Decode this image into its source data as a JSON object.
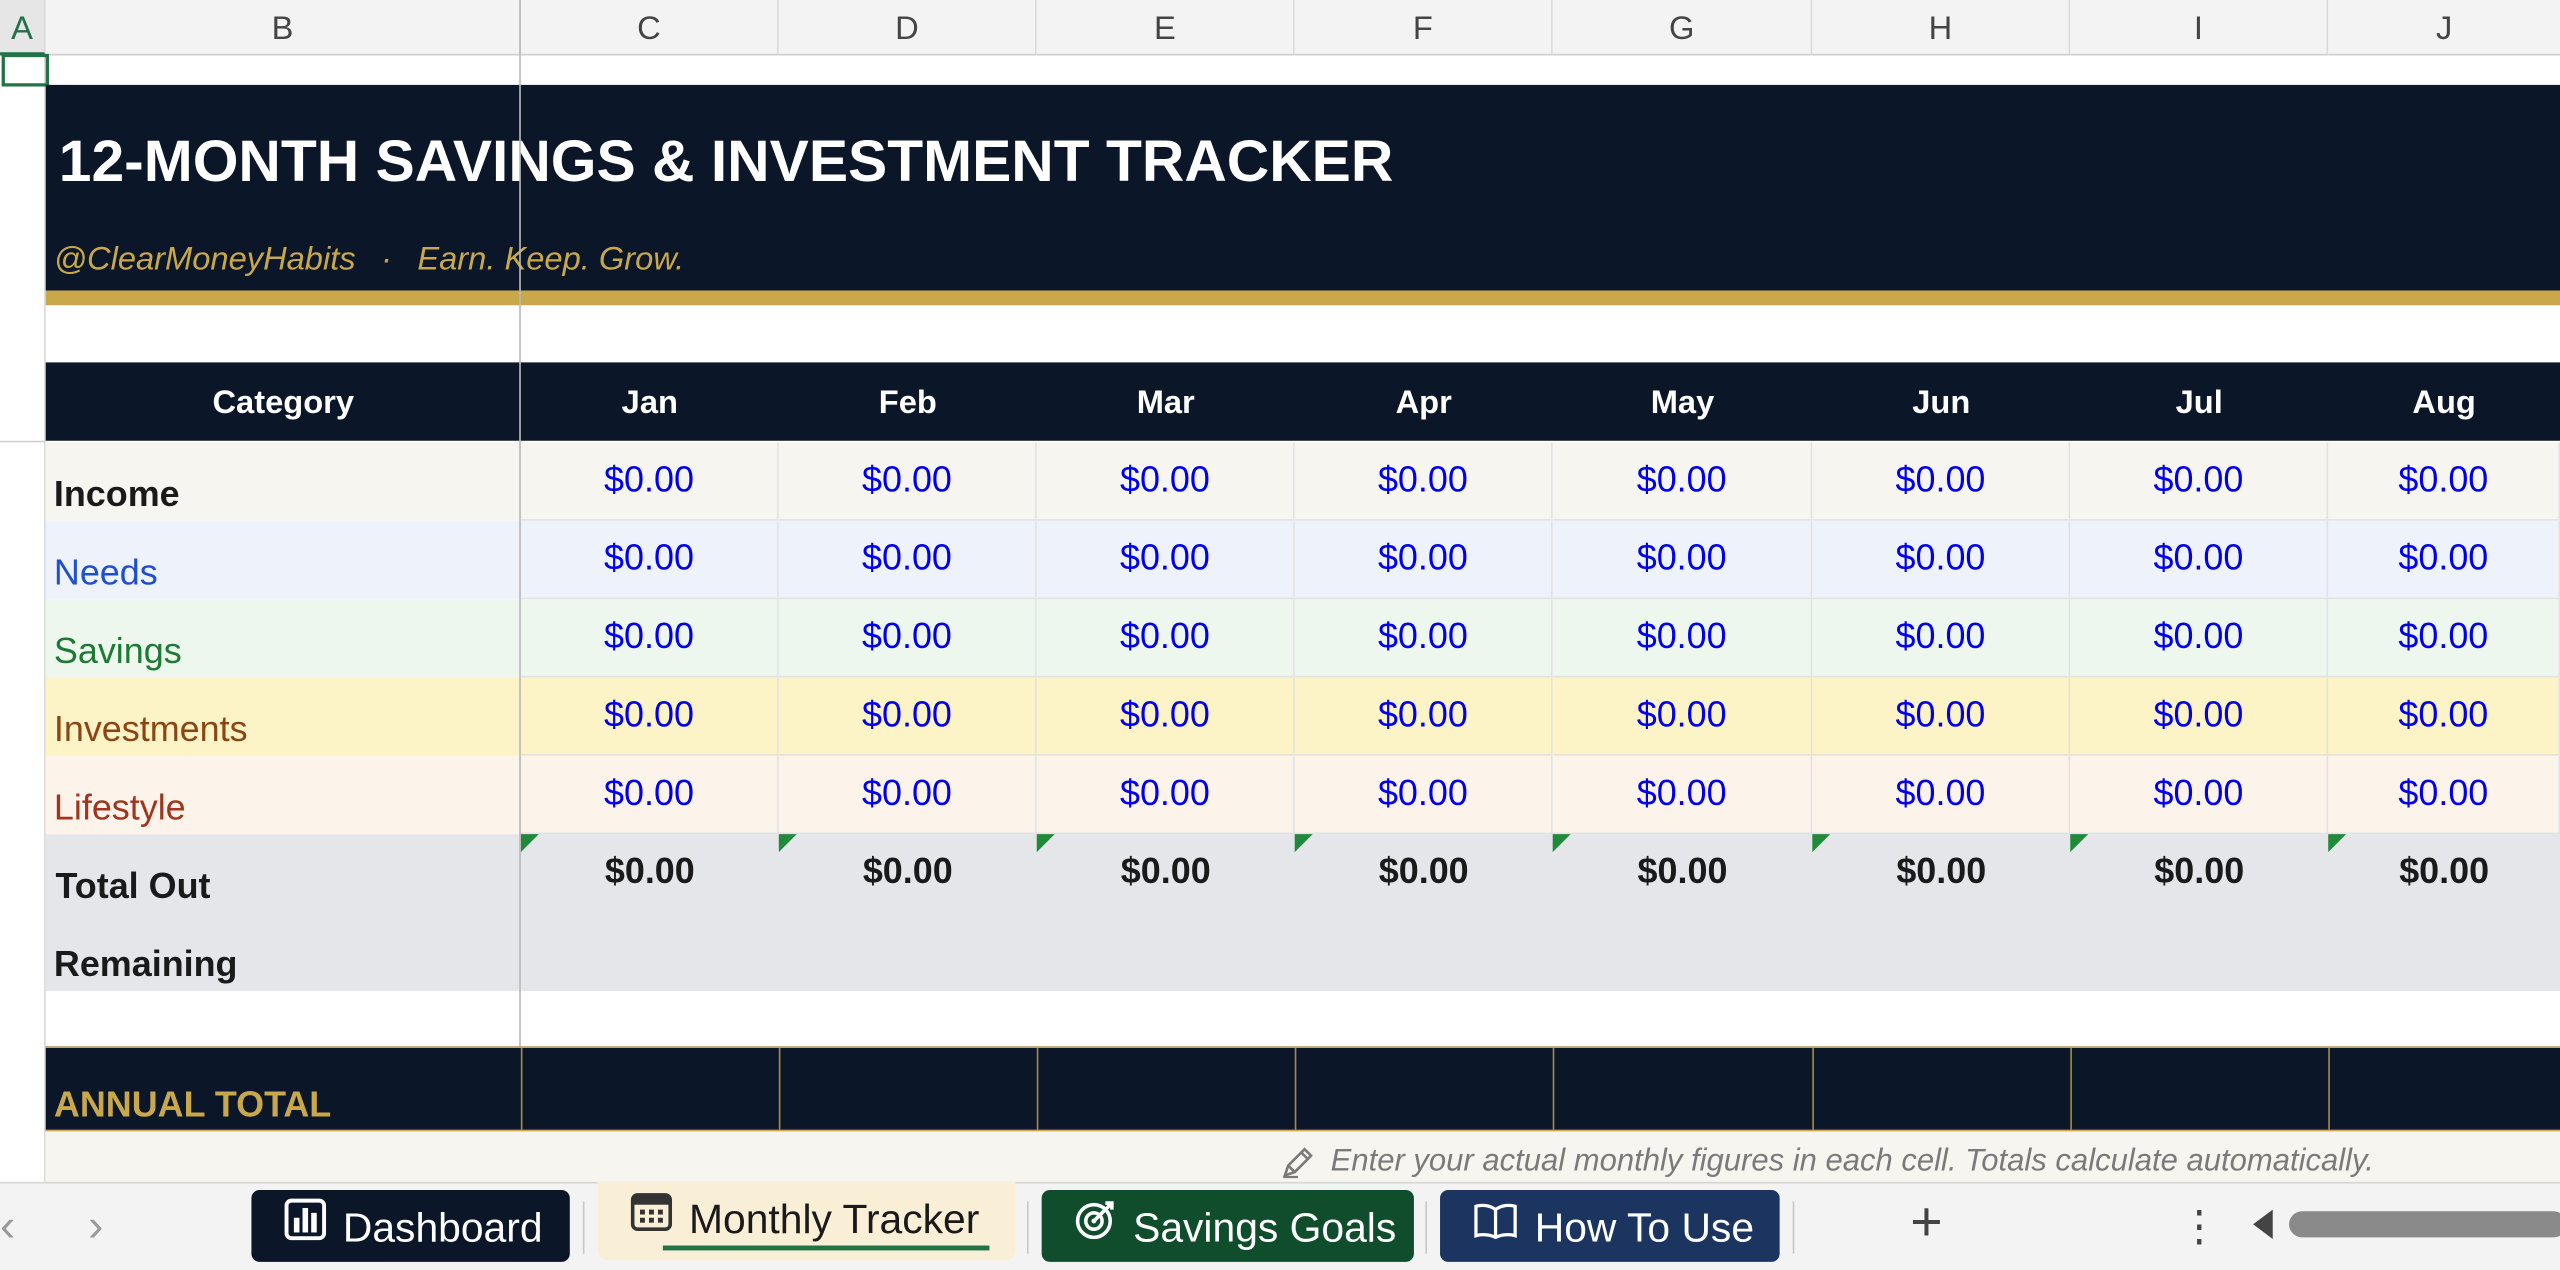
{
  "columns": {
    "letters": [
      "A",
      "B",
      "C",
      "D",
      "E",
      "F",
      "G",
      "H",
      "I",
      "J"
    ]
  },
  "banner": {
    "title": "12-MONTH SAVINGS & INVESTMENT TRACKER",
    "handle": "@ClearMoneyHabits",
    "separator": "·",
    "slogan": "Earn. Keep. Grow."
  },
  "table": {
    "header_category": "Category",
    "months": [
      "Jan",
      "Feb",
      "Mar",
      "Apr",
      "May",
      "Jun",
      "Jul",
      "Aug"
    ],
    "rows": [
      {
        "label": "Income",
        "values": [
          "$0.00",
          "$0.00",
          "$0.00",
          "$0.00",
          "$0.00",
          "$0.00",
          "$0.00",
          "$0.00"
        ]
      },
      {
        "label": "Needs",
        "values": [
          "$0.00",
          "$0.00",
          "$0.00",
          "$0.00",
          "$0.00",
          "$0.00",
          "$0.00",
          "$0.00"
        ]
      },
      {
        "label": "Savings",
        "values": [
          "$0.00",
          "$0.00",
          "$0.00",
          "$0.00",
          "$0.00",
          "$0.00",
          "$0.00",
          "$0.00"
        ]
      },
      {
        "label": "Investments",
        "values": [
          "$0.00",
          "$0.00",
          "$0.00",
          "$0.00",
          "$0.00",
          "$0.00",
          "$0.00",
          "$0.00"
        ]
      },
      {
        "label": "Lifestyle",
        "values": [
          "$0.00",
          "$0.00",
          "$0.00",
          "$0.00",
          "$0.00",
          "$0.00",
          "$0.00",
          "$0.00"
        ]
      },
      {
        "label": "Total Out",
        "values": [
          "$0.00",
          "$0.00",
          "$0.00",
          "$0.00",
          "$0.00",
          "$0.00",
          "$0.00",
          "$0.00"
        ]
      },
      {
        "label": "Remaining",
        "values": [
          "",
          "",
          "",
          "",
          "",
          "",
          "",
          ""
        ]
      }
    ],
    "annual_total_label": "ANNUAL TOTAL",
    "note": "Enter your actual monthly figures in each cell. Totals calculate automatically."
  },
  "colors": {
    "navy": "#0b1628",
    "gold": "#c9a84c",
    "value_blue": "#0000ee",
    "needs_blue": "#1f4fd1",
    "savings_green": "#1c7a34",
    "investments_brown": "#8b4513",
    "lifestyle_red": "#a0341f"
  },
  "sheet_tabs": {
    "prev_icon": "chevron-left-icon",
    "next_icon": "chevron-right-icon",
    "items": [
      {
        "label": "Dashboard",
        "icon": "bar-chart-icon"
      },
      {
        "label": "Monthly Tracker",
        "icon": "calendar-icon",
        "active": true
      },
      {
        "label": "Savings Goals",
        "icon": "target-icon"
      },
      {
        "label": "How To Use",
        "icon": "book-icon"
      }
    ],
    "add_label": "+",
    "more_label": "⋮"
  }
}
